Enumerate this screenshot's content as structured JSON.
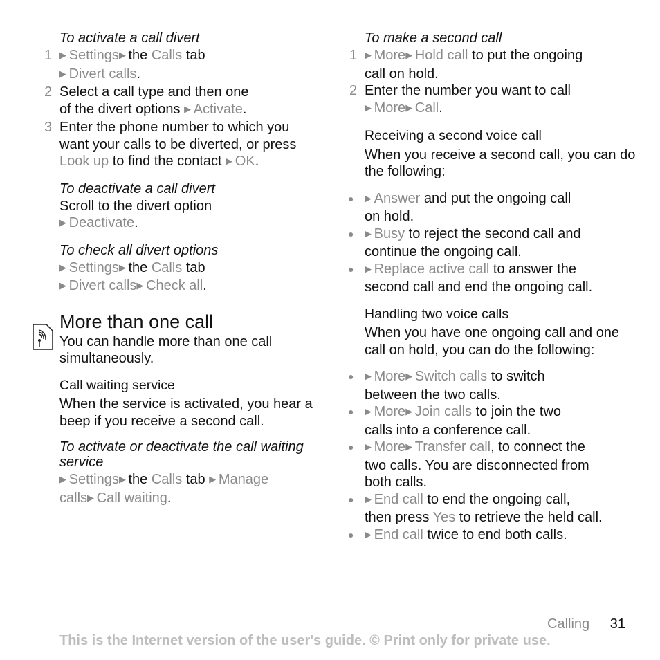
{
  "left": {
    "h1": "To activate a call divert",
    "steps1": [
      {
        "n": "1",
        "parts": [
          [
            "tri",
            ""
          ],
          [
            "g",
            "Settings"
          ],
          [
            "tri",
            ""
          ],
          [
            "t",
            "the "
          ],
          [
            "g",
            "Calls"
          ],
          [
            "t",
            " tab"
          ],
          [
            "br",
            ""
          ],
          [
            "tri",
            ""
          ],
          [
            "g",
            "Divert calls"
          ],
          [
            "t",
            "."
          ]
        ]
      },
      {
        "n": "2",
        "parts": [
          [
            "t",
            "Select a call type and then one"
          ],
          [
            "br",
            ""
          ],
          [
            "t",
            "of the divert options "
          ],
          [
            "tri",
            ""
          ],
          [
            "g",
            "Activate"
          ],
          [
            "t",
            "."
          ]
        ]
      },
      {
        "n": "3",
        "parts": [
          [
            "t",
            "Enter the phone number to which you"
          ],
          [
            "br",
            ""
          ],
          [
            "t",
            "want your calls to be diverted, or press"
          ],
          [
            "br",
            ""
          ],
          [
            "g",
            "Look up"
          ],
          [
            "t",
            " to find the contact "
          ],
          [
            "tri",
            ""
          ],
          [
            "g",
            "OK"
          ],
          [
            "t",
            "."
          ]
        ]
      }
    ],
    "h2": "To deactivate a call divert",
    "p2": [
      [
        "t",
        "Scroll to the divert option"
      ],
      [
        "br",
        ""
      ],
      [
        "tri",
        ""
      ],
      [
        "g",
        "Deactivate"
      ],
      [
        "t",
        "."
      ]
    ],
    "h3": "To check all divert options",
    "p3": [
      [
        "tri",
        ""
      ],
      [
        "g",
        "Settings"
      ],
      [
        "tri",
        ""
      ],
      [
        "t",
        "the "
      ],
      [
        "g",
        "Calls"
      ],
      [
        "t",
        " tab"
      ],
      [
        "br",
        ""
      ],
      [
        "tri",
        ""
      ],
      [
        "g",
        "Divert calls"
      ],
      [
        "tri",
        ""
      ],
      [
        "g",
        "Check all"
      ],
      [
        "t",
        "."
      ]
    ],
    "section_title": "More than one call",
    "section_intro": "You can handle more than one call simultaneously.",
    "h4": "Call waiting service",
    "p4": "When the service is activated, you hear a beep if you receive a second call.",
    "h5": "To activate or deactivate the call waiting service",
    "p5": [
      [
        "tri",
        ""
      ],
      [
        "g",
        "Settings"
      ],
      [
        "tri",
        ""
      ],
      [
        "t",
        "the "
      ],
      [
        "g",
        "Calls"
      ],
      [
        "t",
        " tab "
      ],
      [
        "tri",
        ""
      ],
      [
        "g",
        "Manage"
      ],
      [
        "br",
        ""
      ],
      [
        "g",
        "calls"
      ],
      [
        "tri",
        ""
      ],
      [
        "g",
        "Call waiting"
      ],
      [
        "t",
        "."
      ]
    ]
  },
  "right": {
    "h1": "To make a second call",
    "steps1": [
      {
        "n": "1",
        "parts": [
          [
            "tri",
            ""
          ],
          [
            "g",
            "More"
          ],
          [
            "tri",
            ""
          ],
          [
            "g",
            "Hold call"
          ],
          [
            "t",
            " to put the ongoing"
          ],
          [
            "br",
            ""
          ],
          [
            "t",
            "call on hold."
          ]
        ]
      },
      {
        "n": "2",
        "parts": [
          [
            "t",
            "Enter the number you want to call"
          ],
          [
            "br",
            ""
          ],
          [
            "tri",
            ""
          ],
          [
            "g",
            "More"
          ],
          [
            "tri",
            ""
          ],
          [
            "g",
            "Call"
          ],
          [
            "t",
            "."
          ]
        ]
      }
    ],
    "h2": "Receiving a second voice call",
    "p2": "When you receive a second call, you can do the following:",
    "bullets1": [
      [
        [
          "tri",
          ""
        ],
        [
          "g",
          "Answer"
        ],
        [
          "t",
          " and put the ongoing call"
        ],
        [
          "br",
          ""
        ],
        [
          "t",
          "on hold."
        ]
      ],
      [
        [
          "tri",
          ""
        ],
        [
          "g",
          "Busy"
        ],
        [
          "t",
          " to reject the second call and"
        ],
        [
          "br",
          ""
        ],
        [
          "t",
          "continue the ongoing call."
        ]
      ],
      [
        [
          "tri",
          ""
        ],
        [
          "g",
          "Replace active call"
        ],
        [
          "t",
          " to answer the"
        ],
        [
          "br",
          ""
        ],
        [
          "t",
          "second call and end the ongoing call."
        ]
      ]
    ],
    "h3": "Handling two voice calls",
    "p3": "When you have one ongoing call and one call on hold, you can do the following:",
    "bullets2": [
      [
        [
          "tri",
          ""
        ],
        [
          "g",
          "More"
        ],
        [
          "tri",
          ""
        ],
        [
          "g",
          "Switch calls"
        ],
        [
          "t",
          " to switch"
        ],
        [
          "br",
          ""
        ],
        [
          "t",
          "between the two calls."
        ]
      ],
      [
        [
          "tri",
          ""
        ],
        [
          "g",
          "More"
        ],
        [
          "tri",
          ""
        ],
        [
          "g",
          "Join calls"
        ],
        [
          "t",
          " to join the two"
        ],
        [
          "br",
          ""
        ],
        [
          "t",
          "calls into a conference call."
        ]
      ],
      [
        [
          "tri",
          ""
        ],
        [
          "g",
          "More"
        ],
        [
          "tri",
          ""
        ],
        [
          "g",
          "Transfer call"
        ],
        [
          "t",
          ", to connect the"
        ],
        [
          "br",
          ""
        ],
        [
          "t",
          "two calls. You are disconnected from"
        ],
        [
          "br",
          ""
        ],
        [
          "t",
          "both calls."
        ]
      ],
      [
        [
          "tri",
          ""
        ],
        [
          "g",
          "End call"
        ],
        [
          "t",
          " to end the ongoing call,"
        ],
        [
          "br",
          ""
        ],
        [
          "t",
          "then press "
        ],
        [
          "g",
          "Yes"
        ],
        [
          "t",
          " to retrieve the held call."
        ]
      ],
      [
        [
          "tri",
          ""
        ],
        [
          "g",
          "End call"
        ],
        [
          "t",
          " twice to end both calls."
        ]
      ]
    ]
  },
  "footer": {
    "chapter": "Calling",
    "page": "31",
    "note": "This is the Internet version of the user's guide. © Print only for private use."
  }
}
